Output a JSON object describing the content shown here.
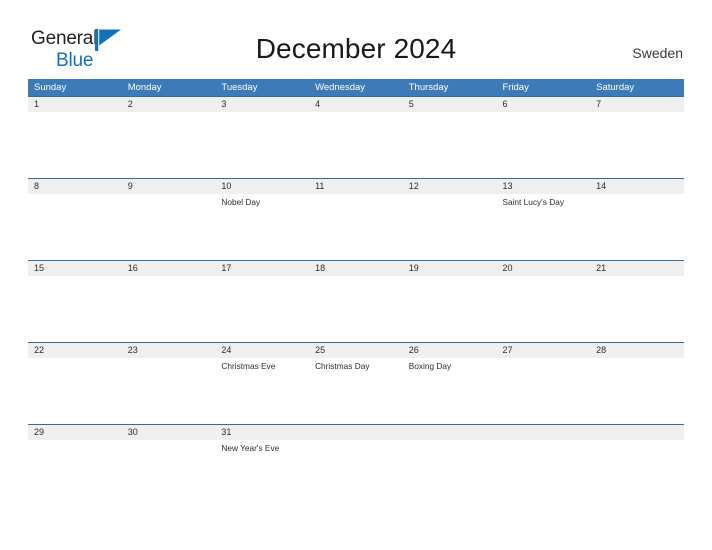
{
  "brand": {
    "word_one": "General",
    "word_two": "Blue",
    "flag_icon": "flag-triangle-icon",
    "accent_color": "#1272bb"
  },
  "header": {
    "title": "December 2024",
    "country": "Sweden"
  },
  "theme": {
    "header_blue": "#3d7ab8",
    "row_line_blue": "#2f6ca6",
    "date_band_gray": "#efefef",
    "text_color": "#2d2d2d"
  },
  "calendar": {
    "weekdays": [
      "Sunday",
      "Monday",
      "Tuesday",
      "Wednesday",
      "Thursday",
      "Friday",
      "Saturday"
    ],
    "weeks": [
      {
        "days": [
          {
            "date": "1",
            "event": ""
          },
          {
            "date": "2",
            "event": ""
          },
          {
            "date": "3",
            "event": ""
          },
          {
            "date": "4",
            "event": ""
          },
          {
            "date": "5",
            "event": ""
          },
          {
            "date": "6",
            "event": ""
          },
          {
            "date": "7",
            "event": ""
          }
        ]
      },
      {
        "days": [
          {
            "date": "8",
            "event": ""
          },
          {
            "date": "9",
            "event": ""
          },
          {
            "date": "10",
            "event": "Nobel Day"
          },
          {
            "date": "11",
            "event": ""
          },
          {
            "date": "12",
            "event": ""
          },
          {
            "date": "13",
            "event": "Saint Lucy's Day"
          },
          {
            "date": "14",
            "event": ""
          }
        ]
      },
      {
        "days": [
          {
            "date": "15",
            "event": ""
          },
          {
            "date": "16",
            "event": ""
          },
          {
            "date": "17",
            "event": ""
          },
          {
            "date": "18",
            "event": ""
          },
          {
            "date": "19",
            "event": ""
          },
          {
            "date": "20",
            "event": ""
          },
          {
            "date": "21",
            "event": ""
          }
        ]
      },
      {
        "days": [
          {
            "date": "22",
            "event": ""
          },
          {
            "date": "23",
            "event": ""
          },
          {
            "date": "24",
            "event": "Christmas Eve"
          },
          {
            "date": "25",
            "event": "Christmas Day"
          },
          {
            "date": "26",
            "event": "Boxing Day"
          },
          {
            "date": "27",
            "event": ""
          },
          {
            "date": "28",
            "event": ""
          }
        ]
      },
      {
        "days": [
          {
            "date": "29",
            "event": ""
          },
          {
            "date": "30",
            "event": ""
          },
          {
            "date": "31",
            "event": "New Year's Eve"
          },
          {
            "date": "",
            "event": ""
          },
          {
            "date": "",
            "event": ""
          },
          {
            "date": "",
            "event": ""
          },
          {
            "date": "",
            "event": ""
          }
        ]
      }
    ]
  }
}
